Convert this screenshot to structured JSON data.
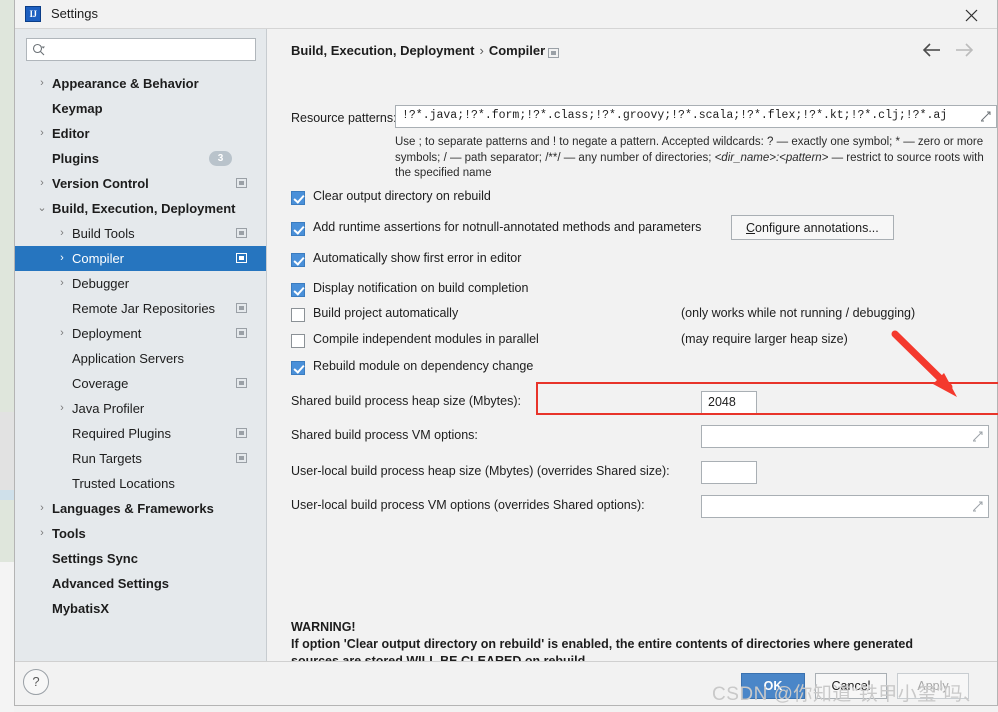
{
  "window": {
    "title": "Settings",
    "app_icon": "intellij-idea-icon",
    "close_icon": "close-icon"
  },
  "sidebar": {
    "search": {
      "value": "",
      "placeholder": "",
      "icon": "search-icon"
    },
    "items": [
      {
        "label": "Appearance & Behavior",
        "level": 0,
        "arrow": "›",
        "bold": true,
        "selected": false,
        "copy": false,
        "badge": null
      },
      {
        "label": "Keymap",
        "level": 0,
        "arrow": "",
        "bold": true,
        "selected": false,
        "copy": false,
        "badge": null
      },
      {
        "label": "Editor",
        "level": 0,
        "arrow": "›",
        "bold": true,
        "selected": false,
        "copy": false,
        "badge": null
      },
      {
        "label": "Plugins",
        "level": 0,
        "arrow": "",
        "bold": true,
        "selected": false,
        "copy": false,
        "badge": "3"
      },
      {
        "label": "Version Control",
        "level": 0,
        "arrow": "›",
        "bold": true,
        "selected": false,
        "copy": true,
        "badge": null
      },
      {
        "label": "Build, Execution, Deployment",
        "level": 0,
        "arrow": "⌄",
        "bold": true,
        "selected": false,
        "copy": false,
        "badge": null
      },
      {
        "label": "Build Tools",
        "level": 1,
        "arrow": "›",
        "bold": false,
        "selected": false,
        "copy": true,
        "badge": null
      },
      {
        "label": "Compiler",
        "level": 1,
        "arrow": "›",
        "bold": false,
        "selected": true,
        "copy": true,
        "badge": null
      },
      {
        "label": "Debugger",
        "level": 1,
        "arrow": "›",
        "bold": false,
        "selected": false,
        "copy": false,
        "badge": null
      },
      {
        "label": "Remote Jar Repositories",
        "level": 1,
        "arrow": "",
        "bold": false,
        "selected": false,
        "copy": true,
        "badge": null
      },
      {
        "label": "Deployment",
        "level": 1,
        "arrow": "›",
        "bold": false,
        "selected": false,
        "copy": true,
        "badge": null
      },
      {
        "label": "Application Servers",
        "level": 1,
        "arrow": "",
        "bold": false,
        "selected": false,
        "copy": false,
        "badge": null
      },
      {
        "label": "Coverage",
        "level": 1,
        "arrow": "",
        "bold": false,
        "selected": false,
        "copy": true,
        "badge": null
      },
      {
        "label": "Java Profiler",
        "level": 1,
        "arrow": "›",
        "bold": false,
        "selected": false,
        "copy": false,
        "badge": null
      },
      {
        "label": "Required Plugins",
        "level": 1,
        "arrow": "",
        "bold": false,
        "selected": false,
        "copy": true,
        "badge": null
      },
      {
        "label": "Run Targets",
        "level": 1,
        "arrow": "",
        "bold": false,
        "selected": false,
        "copy": true,
        "badge": null
      },
      {
        "label": "Trusted Locations",
        "level": 1,
        "arrow": "",
        "bold": false,
        "selected": false,
        "copy": false,
        "badge": null
      },
      {
        "label": "Languages & Frameworks",
        "level": 0,
        "arrow": "›",
        "bold": true,
        "selected": false,
        "copy": false,
        "badge": null
      },
      {
        "label": "Tools",
        "level": 0,
        "arrow": "›",
        "bold": true,
        "selected": false,
        "copy": false,
        "badge": null
      },
      {
        "label": "Settings Sync",
        "level": 0,
        "arrow": "",
        "bold": true,
        "selected": false,
        "copy": false,
        "badge": null
      },
      {
        "label": "Advanced Settings",
        "level": 0,
        "arrow": "",
        "bold": true,
        "selected": false,
        "copy": false,
        "badge": null
      },
      {
        "label": "MybatisX",
        "level": 0,
        "arrow": "",
        "bold": true,
        "selected": false,
        "copy": false,
        "badge": null
      }
    ]
  },
  "content": {
    "breadcrumb": {
      "root": "Build, Execution, Deployment",
      "separator": "›",
      "leaf": "Compiler"
    },
    "nav": {
      "back_icon": "arrow-left-icon",
      "forward_icon": "arrow-right-icon"
    },
    "resource_patterns": {
      "label": "Resource patterns:",
      "value": "!?*.java;!?*.form;!?*.class;!?*.groovy;!?*.scala;!?*.flex;!?*.kt;!?*.clj;!?*.aj",
      "expand_icon": "expand-icon",
      "hint_line1": "Use ; to separate patterns and ! to negate a pattern. Accepted wildcards: ? — exactly one symbol; * — zero",
      "hint_line2_a": "or more symbols; / — path separator; /**/ — any number of directories;  ",
      "hint_line2_italic": "<dir_name>:<pattern>",
      "hint_line2_b": " — restrict to",
      "hint_line3": "source roots with the specified name"
    },
    "checkboxes": [
      {
        "label": "Clear output directory on rebuild",
        "checked": true,
        "note": ""
      },
      {
        "label": "Add runtime assertions for notnull-annotated methods and parameters",
        "checked": true,
        "note": ""
      },
      {
        "label": "Automatically show first error in editor",
        "checked": true,
        "note": ""
      },
      {
        "label": "Display notification on build completion",
        "checked": true,
        "note": ""
      },
      {
        "label": "Build project automatically",
        "checked": false,
        "note": "(only works while not running / debugging)"
      },
      {
        "label": "Compile independent modules in parallel",
        "checked": false,
        "note": "(may require larger heap size)"
      },
      {
        "label": "Rebuild module on dependency change",
        "checked": true,
        "note": ""
      }
    ],
    "configure_annotations_button": "Configure annotations...",
    "fields": [
      {
        "label": "Shared build process heap size (Mbytes):",
        "value": "2048",
        "kind": "short",
        "highlighted": true
      },
      {
        "label": "Shared build process VM options:",
        "value": "",
        "kind": "long",
        "highlighted": false
      },
      {
        "label": "User-local build process heap size (Mbytes) (overrides Shared size):",
        "value": "",
        "kind": "short",
        "highlighted": false
      },
      {
        "label": "User-local build process VM options (overrides Shared options):",
        "value": "",
        "kind": "long",
        "highlighted": false
      }
    ],
    "warning": {
      "title": "WARNING!",
      "line1": "If option 'Clear output directory on rebuild' is enabled, the entire contents of directories where generated",
      "line2": "sources are stored WILL BE CLEARED on rebuild."
    }
  },
  "footer": {
    "help_label": "?",
    "ok_label": "OK",
    "cancel_label": "Cancel",
    "apply_label": "Apply"
  },
  "annotations": {
    "watermark": "CSDN @你知道“铁甲小玺”吗、",
    "arrow_color": "#f4392d",
    "highlight_color": "#e8342a"
  },
  "colors": {
    "accent_selection": "#2675bf",
    "checkbox_checked": "#4a90d9",
    "primary_button": "#4a86c8",
    "sidebar_bg": "#e5e9ec",
    "content_bg": "#f2f2f2"
  }
}
